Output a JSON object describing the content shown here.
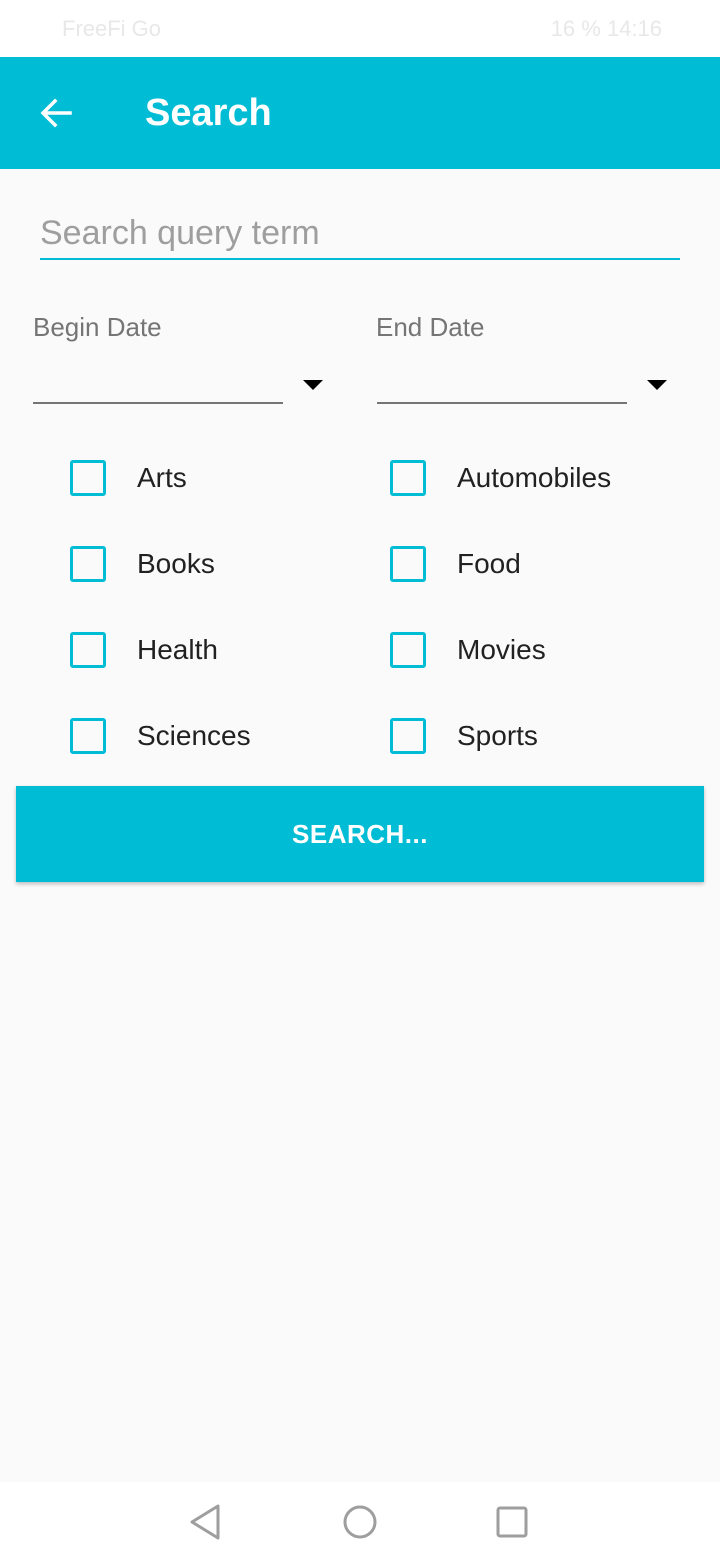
{
  "status_bar": {
    "left_text": "FreeFi Go",
    "right_text": "16 %  14:16"
  },
  "app_bar": {
    "title": "Search",
    "back_icon": "arrow-left-icon"
  },
  "search": {
    "placeholder": "Search query term",
    "value": ""
  },
  "dates": {
    "begin_label": "Begin Date",
    "end_label": "End Date",
    "begin_value": "",
    "end_value": ""
  },
  "categories": [
    {
      "label": "Arts",
      "checked": false
    },
    {
      "label": "Automobiles",
      "checked": false
    },
    {
      "label": "Books",
      "checked": false
    },
    {
      "label": "Food",
      "checked": false
    },
    {
      "label": "Health",
      "checked": false
    },
    {
      "label": "Movies",
      "checked": false
    },
    {
      "label": "Sciences",
      "checked": false
    },
    {
      "label": "Sports",
      "checked": false
    }
  ],
  "search_button": {
    "label": "SEARCH..."
  },
  "nav_bar": {
    "back_icon": "triangle-back-icon",
    "home_icon": "circle-home-icon",
    "recents_icon": "square-recents-icon"
  },
  "colors": {
    "accent": "#00bcd4",
    "background": "#fafafa",
    "text": "#212121",
    "hint": "#9e9e9e"
  }
}
